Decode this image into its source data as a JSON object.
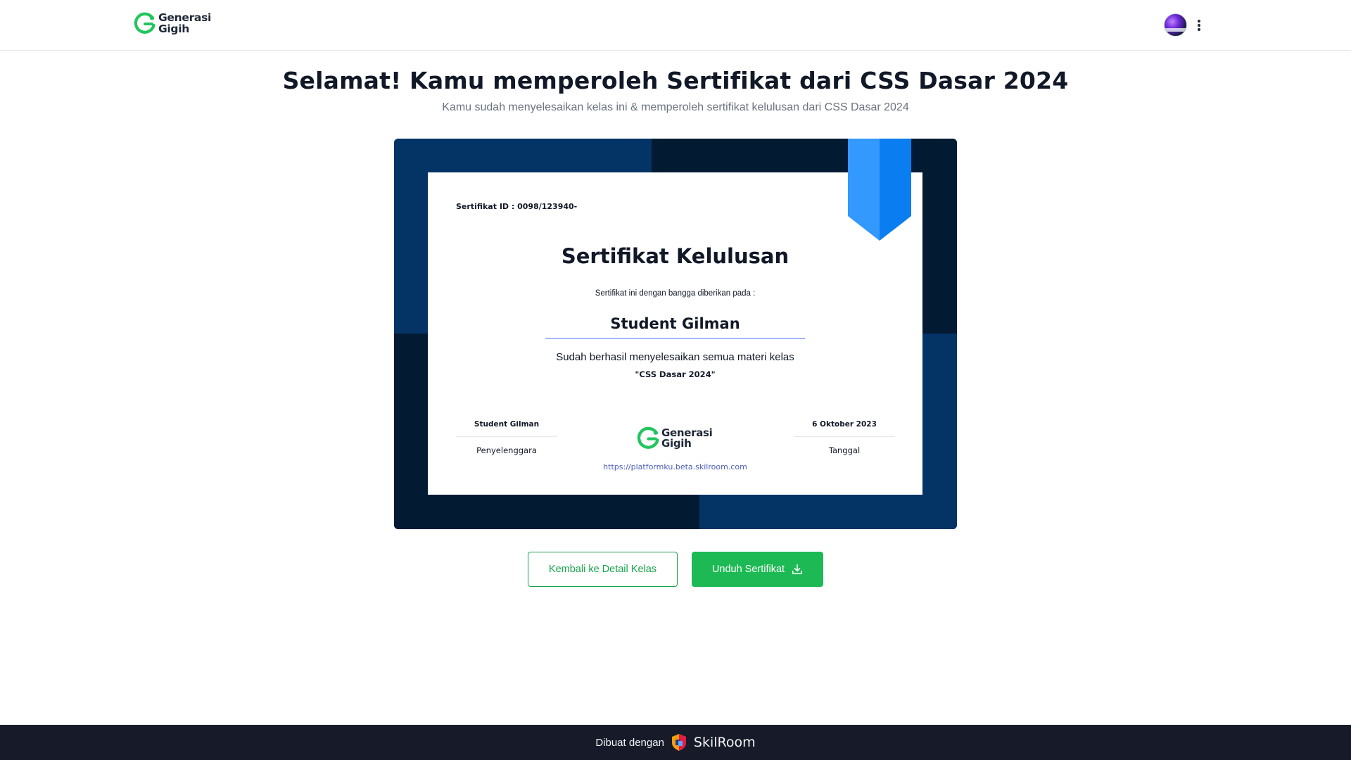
{
  "header": {
    "logo": {
      "line1": "Generasi",
      "line2": "Gigih"
    },
    "icons": {
      "avatar": "user-avatar",
      "menu": "kebab-menu-icon"
    }
  },
  "main": {
    "title": "Selamat! Kamu memperoleh Sertifikat dari CSS Dasar 2024",
    "subtitle": "Kamu sudah menyelesaikan kelas ini & memperoleh sertifikat kelulusan dari CSS Dasar 2024"
  },
  "certificate": {
    "id_label": "Sertifikat ID : 0098/123940-",
    "title": "Sertifikat Kelulusan",
    "given_to": "Sertifikat ini dengan bangga diberikan pada :",
    "recipient": "Student Gilman",
    "completed_text": "Sudah berhasil menyelesaikan semua materi kelas",
    "course": "\"CSS Dasar 2024\"",
    "organizer_name": "Student Gilman",
    "organizer_label": "Penyelenggara",
    "date_value": "6 Oktober 2023",
    "date_label": "Tanggal",
    "logo": {
      "line1": "Generasi",
      "line2": "Gigih"
    },
    "url": "https://platformku.beta.skilroom.com",
    "colors": {
      "navy_dark": "#031a33",
      "navy": "#043366",
      "ribbon": "#1a8cff"
    }
  },
  "actions": {
    "back_label": "Kembali ke Detail Kelas",
    "download_label": "Unduh Sertifikat",
    "download_icon": "download-icon"
  },
  "footer": {
    "label": "Dibuat dengan",
    "brand": "SkilRoom",
    "icon": "skilroom-logo-icon"
  },
  "colors": {
    "accent": "#1db954",
    "footer_bg": "#171b29"
  }
}
